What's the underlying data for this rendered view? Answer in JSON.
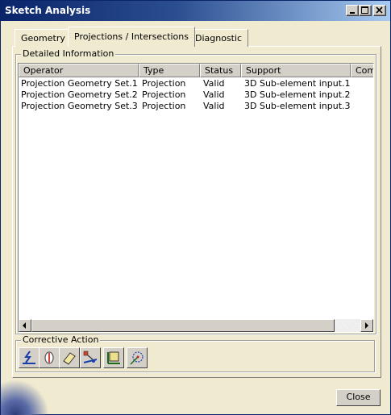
{
  "window": {
    "title": "Sketch Analysis"
  },
  "tabs": [
    {
      "label": "Geometry"
    },
    {
      "label": "Projections / Intersections"
    },
    {
      "label": "Diagnostic"
    }
  ],
  "detailed": {
    "legend": "Detailed Information",
    "columns": [
      "Operator",
      "Type",
      "Status",
      "Support",
      "Comm"
    ],
    "rows": [
      [
        "Projection Geometry Set.1",
        "Projection",
        "Valid",
        "3D Sub-element input.1",
        ""
      ],
      [
        "Projection Geometry Set.2",
        "Projection",
        "Valid",
        "3D Sub-element input.2",
        ""
      ],
      [
        "Projection Geometry Set.3",
        "Projection",
        "Valid",
        "3D Sub-element input.3",
        ""
      ]
    ]
  },
  "corrective": {
    "legend": "Corrective Action",
    "actions": [
      "construction-toggle-icon",
      "isolate-icon",
      "eraser-icon",
      "replace-icon",
      "hide-constraint-icon",
      "show-geometry-icon"
    ]
  },
  "footer": {
    "close_label": "Close"
  }
}
